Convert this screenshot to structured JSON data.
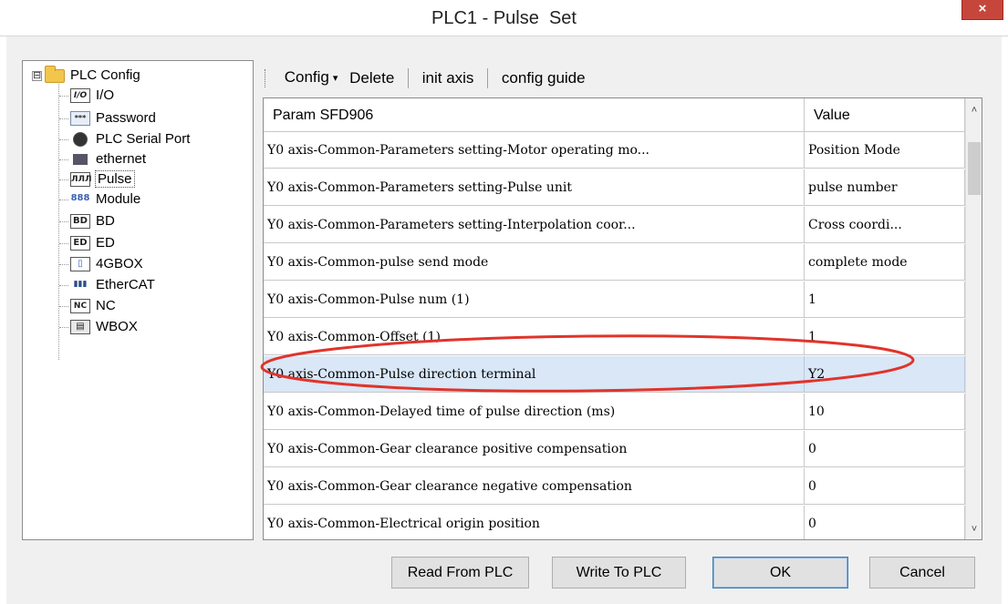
{
  "window": {
    "title": "PLC1 - Pulse  Set",
    "close_label": "×"
  },
  "tree": {
    "root": {
      "label": "PLC Config",
      "expander": "⊟"
    },
    "items": [
      {
        "label": "I/O",
        "icon": "I/O"
      },
      {
        "label": "Password",
        "icon": "***"
      },
      {
        "label": "PLC Serial Port",
        "icon": ""
      },
      {
        "label": "ethernet",
        "icon": ""
      },
      {
        "label": "Pulse",
        "icon": "ЛЛЛ"
      },
      {
        "label": "Module",
        "icon": "888"
      },
      {
        "label": "BD",
        "icon": "BD"
      },
      {
        "label": "ED",
        "icon": "ED"
      },
      {
        "label": "4GBOX",
        "icon": "▯"
      },
      {
        "label": "EtherCAT",
        "icon": "▮▮▮"
      },
      {
        "label": "NC",
        "icon": "NC"
      },
      {
        "label": "WBOX",
        "icon": "▤"
      }
    ],
    "selected": "Pulse"
  },
  "toolbar": {
    "config_label": "Config",
    "config_caret": "▾",
    "delete_label": "Delete",
    "init_axis_label": "init axis",
    "config_guide_label": "config guide"
  },
  "grid": {
    "header_param": "Param SFD906",
    "header_value": "Value",
    "rows": [
      {
        "param": "Y0 axis-Common-Parameters setting-Motor operating mo...",
        "value": "Position Mode"
      },
      {
        "param": "Y0 axis-Common-Parameters setting-Pulse unit",
        "value": "pulse number"
      },
      {
        "param": "Y0 axis-Common-Parameters setting-Interpolation coor...",
        "value": "Cross coordi..."
      },
      {
        "param": "Y0 axis-Common-pulse send mode",
        "value": "complete mode"
      },
      {
        "param": "Y0 axis-Common-Pulse num (1)",
        "value": "1"
      },
      {
        "param": "Y0 axis-Common-Offset (1)",
        "value": "1"
      },
      {
        "param": "Y0 axis-Common-Pulse direction terminal",
        "value": "Y2"
      },
      {
        "param": "Y0 axis-Common-Delayed time of pulse direction (ms)",
        "value": "10"
      },
      {
        "param": "Y0 axis-Common-Gear clearance positive compensation",
        "value": "0"
      },
      {
        "param": "Y0 axis-Common-Gear clearance negative compensation",
        "value": "0"
      },
      {
        "param": "Y0 axis-Common-Electrical origin position",
        "value": "0"
      }
    ],
    "highlighted_row": 6,
    "scroll_up": "˄",
    "scroll_down": "˅"
  },
  "buttons": {
    "read_label": "Read From PLC",
    "write_label": "Write To PLC",
    "ok_label": "OK",
    "cancel_label": "Cancel"
  },
  "colors": {
    "highlight_row": "#d9e7f7",
    "annotation": "#e0342b",
    "close_button": "#c7463b"
  }
}
